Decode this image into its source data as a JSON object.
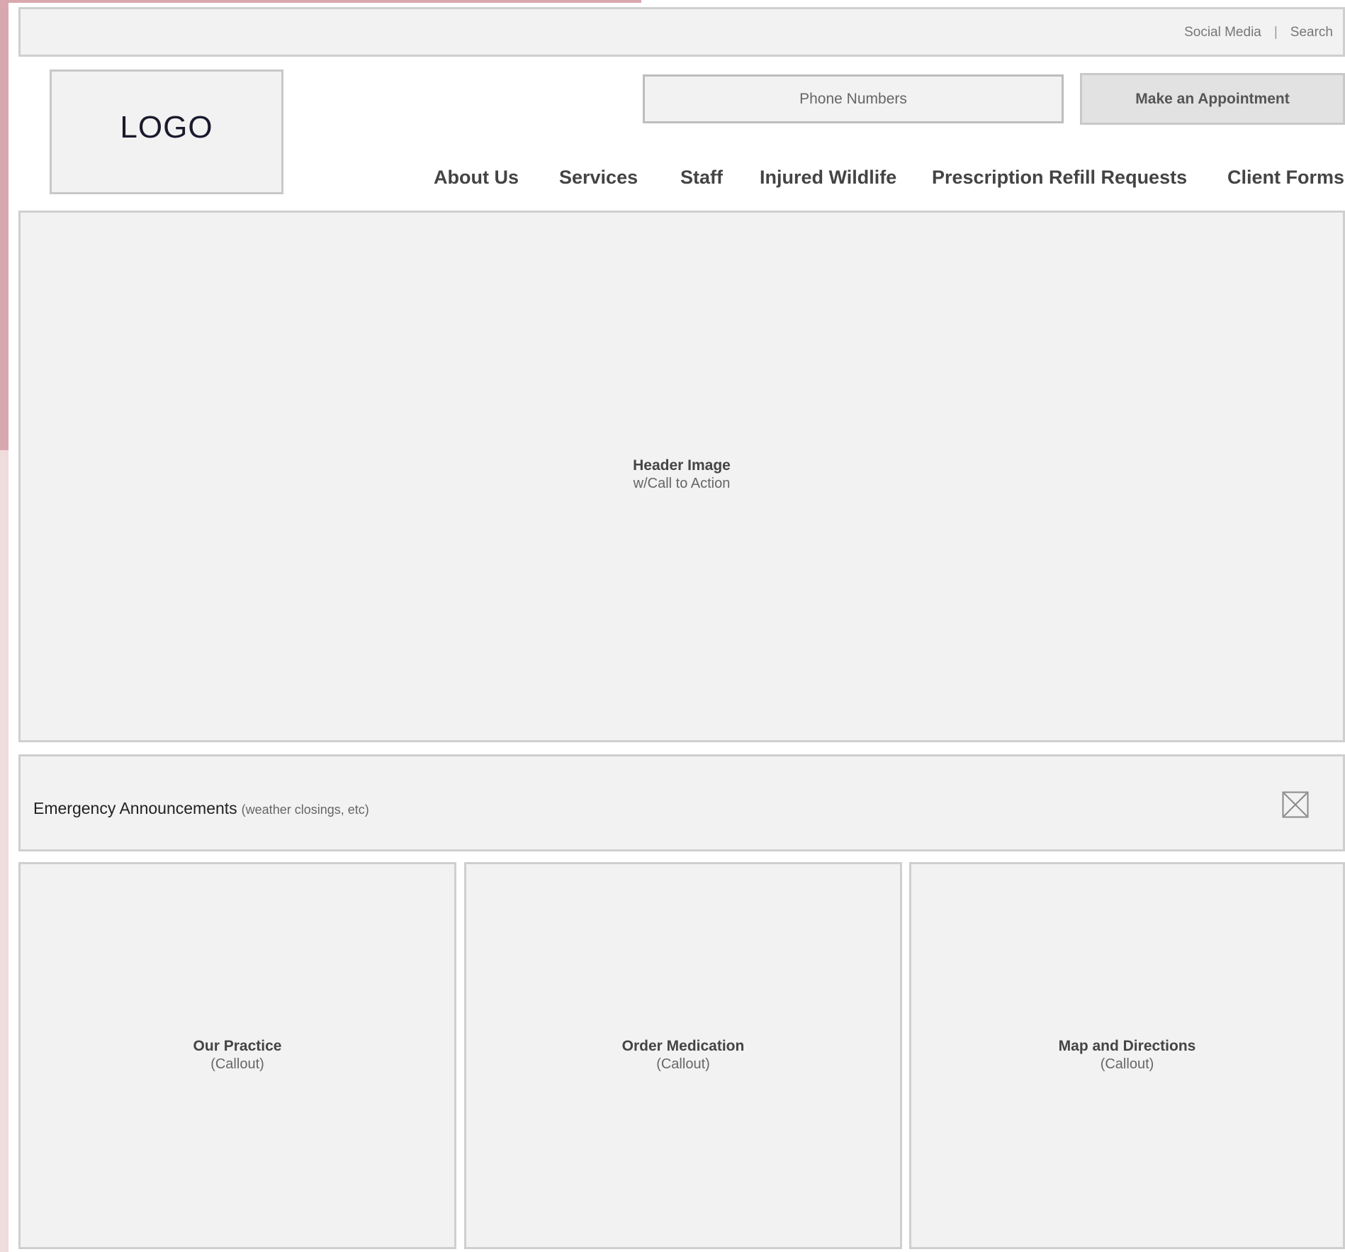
{
  "utility": {
    "social_media": "Social Media",
    "separator": "|",
    "search": "Search"
  },
  "logo": {
    "text": "LOGO"
  },
  "header": {
    "phone_numbers": "Phone Numbers",
    "appointment_button": "Make an Appointment"
  },
  "nav": {
    "items": [
      {
        "label": "About Us"
      },
      {
        "label": "Services"
      },
      {
        "label": "Staff"
      },
      {
        "label": "Injured Wildlife"
      },
      {
        "label": "Prescription Refill Requests"
      },
      {
        "label": "Client Forms"
      }
    ]
  },
  "hero": {
    "title": "Header Image",
    "subtitle": "w/Call to Action"
  },
  "emergency": {
    "title": "Emergency Announcements",
    "note": "(weather closings, etc)",
    "close_icon": "close-box-icon"
  },
  "callouts": [
    {
      "title": "Our Practice",
      "subtitle": "(Callout)"
    },
    {
      "title": "Order Medication",
      "subtitle": "(Callout)"
    },
    {
      "title": "Map and Directions",
      "subtitle": "(Callout)"
    }
  ]
}
